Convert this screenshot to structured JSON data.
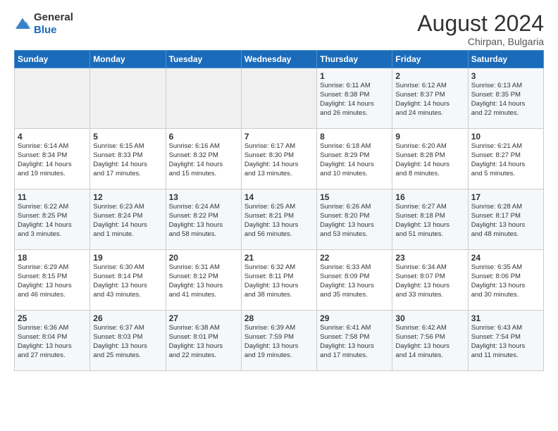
{
  "header": {
    "logo_general": "General",
    "logo_blue": "Blue",
    "month_year": "August 2024",
    "location": "Chirpan, Bulgaria"
  },
  "days_of_week": [
    "Sunday",
    "Monday",
    "Tuesday",
    "Wednesday",
    "Thursday",
    "Friday",
    "Saturday"
  ],
  "weeks": [
    [
      {
        "num": "",
        "info": ""
      },
      {
        "num": "",
        "info": ""
      },
      {
        "num": "",
        "info": ""
      },
      {
        "num": "",
        "info": ""
      },
      {
        "num": "1",
        "info": "Sunrise: 6:11 AM\nSunset: 8:38 PM\nDaylight: 14 hours\nand 26 minutes."
      },
      {
        "num": "2",
        "info": "Sunrise: 6:12 AM\nSunset: 8:37 PM\nDaylight: 14 hours\nand 24 minutes."
      },
      {
        "num": "3",
        "info": "Sunrise: 6:13 AM\nSunset: 8:35 PM\nDaylight: 14 hours\nand 22 minutes."
      }
    ],
    [
      {
        "num": "4",
        "info": "Sunrise: 6:14 AM\nSunset: 8:34 PM\nDaylight: 14 hours\nand 19 minutes."
      },
      {
        "num": "5",
        "info": "Sunrise: 6:15 AM\nSunset: 8:33 PM\nDaylight: 14 hours\nand 17 minutes."
      },
      {
        "num": "6",
        "info": "Sunrise: 6:16 AM\nSunset: 8:32 PM\nDaylight: 14 hours\nand 15 minutes."
      },
      {
        "num": "7",
        "info": "Sunrise: 6:17 AM\nSunset: 8:30 PM\nDaylight: 14 hours\nand 13 minutes."
      },
      {
        "num": "8",
        "info": "Sunrise: 6:18 AM\nSunset: 8:29 PM\nDaylight: 14 hours\nand 10 minutes."
      },
      {
        "num": "9",
        "info": "Sunrise: 6:20 AM\nSunset: 8:28 PM\nDaylight: 14 hours\nand 8 minutes."
      },
      {
        "num": "10",
        "info": "Sunrise: 6:21 AM\nSunset: 8:27 PM\nDaylight: 14 hours\nand 5 minutes."
      }
    ],
    [
      {
        "num": "11",
        "info": "Sunrise: 6:22 AM\nSunset: 8:25 PM\nDaylight: 14 hours\nand 3 minutes."
      },
      {
        "num": "12",
        "info": "Sunrise: 6:23 AM\nSunset: 8:24 PM\nDaylight: 14 hours\nand 1 minute."
      },
      {
        "num": "13",
        "info": "Sunrise: 6:24 AM\nSunset: 8:22 PM\nDaylight: 13 hours\nand 58 minutes."
      },
      {
        "num": "14",
        "info": "Sunrise: 6:25 AM\nSunset: 8:21 PM\nDaylight: 13 hours\nand 56 minutes."
      },
      {
        "num": "15",
        "info": "Sunrise: 6:26 AM\nSunset: 8:20 PM\nDaylight: 13 hours\nand 53 minutes."
      },
      {
        "num": "16",
        "info": "Sunrise: 6:27 AM\nSunset: 8:18 PM\nDaylight: 13 hours\nand 51 minutes."
      },
      {
        "num": "17",
        "info": "Sunrise: 6:28 AM\nSunset: 8:17 PM\nDaylight: 13 hours\nand 48 minutes."
      }
    ],
    [
      {
        "num": "18",
        "info": "Sunrise: 6:29 AM\nSunset: 8:15 PM\nDaylight: 13 hours\nand 46 minutes."
      },
      {
        "num": "19",
        "info": "Sunrise: 6:30 AM\nSunset: 8:14 PM\nDaylight: 13 hours\nand 43 minutes."
      },
      {
        "num": "20",
        "info": "Sunrise: 6:31 AM\nSunset: 8:12 PM\nDaylight: 13 hours\nand 41 minutes."
      },
      {
        "num": "21",
        "info": "Sunrise: 6:32 AM\nSunset: 8:11 PM\nDaylight: 13 hours\nand 38 minutes."
      },
      {
        "num": "22",
        "info": "Sunrise: 6:33 AM\nSunset: 8:09 PM\nDaylight: 13 hours\nand 35 minutes."
      },
      {
        "num": "23",
        "info": "Sunrise: 6:34 AM\nSunset: 8:07 PM\nDaylight: 13 hours\nand 33 minutes."
      },
      {
        "num": "24",
        "info": "Sunrise: 6:35 AM\nSunset: 8:06 PM\nDaylight: 13 hours\nand 30 minutes."
      }
    ],
    [
      {
        "num": "25",
        "info": "Sunrise: 6:36 AM\nSunset: 8:04 PM\nDaylight: 13 hours\nand 27 minutes."
      },
      {
        "num": "26",
        "info": "Sunrise: 6:37 AM\nSunset: 8:03 PM\nDaylight: 13 hours\nand 25 minutes."
      },
      {
        "num": "27",
        "info": "Sunrise: 6:38 AM\nSunset: 8:01 PM\nDaylight: 13 hours\nand 22 minutes."
      },
      {
        "num": "28",
        "info": "Sunrise: 6:39 AM\nSunset: 7:59 PM\nDaylight: 13 hours\nand 19 minutes."
      },
      {
        "num": "29",
        "info": "Sunrise: 6:41 AM\nSunset: 7:58 PM\nDaylight: 13 hours\nand 17 minutes."
      },
      {
        "num": "30",
        "info": "Sunrise: 6:42 AM\nSunset: 7:56 PM\nDaylight: 13 hours\nand 14 minutes."
      },
      {
        "num": "31",
        "info": "Sunrise: 6:43 AM\nSunset: 7:54 PM\nDaylight: 13 hours\nand 11 minutes."
      }
    ]
  ]
}
